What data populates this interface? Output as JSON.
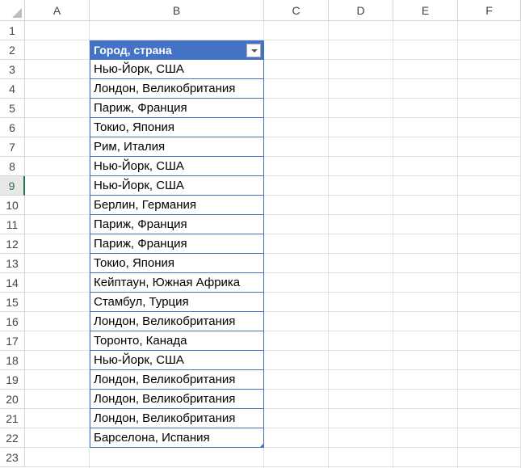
{
  "columns": [
    "A",
    "B",
    "C",
    "D",
    "E",
    "F"
  ],
  "rows": [
    "1",
    "2",
    "3",
    "4",
    "5",
    "6",
    "7",
    "8",
    "9",
    "10",
    "11",
    "12",
    "13",
    "14",
    "15",
    "16",
    "17",
    "18",
    "19",
    "20",
    "21",
    "22",
    "23"
  ],
  "active_row": "9",
  "table": {
    "header": "Город, страна",
    "rows": [
      "Нью-Йорк, США",
      "Лондон, Великобритания",
      "Париж, Франция",
      "Токио, Япония",
      "Рим, Италия",
      "Нью-Йорк, США",
      "Нью-Йорк, США",
      "Берлин, Германия",
      "Париж, Франция",
      "Париж, Франция",
      "Токио, Япония",
      "Кейптаун, Южная Африка",
      "Стамбул, Турция",
      "Лондон, Великобритания",
      "Торонто, Канада",
      "Нью-Йорк, США",
      "Лондон, Великобритания",
      "Лондон, Великобритания",
      "Лондон, Великобритания",
      "Барселона, Испания"
    ]
  },
  "colors": {
    "table_header": "#4472c4",
    "active_row_header": "#217346"
  }
}
